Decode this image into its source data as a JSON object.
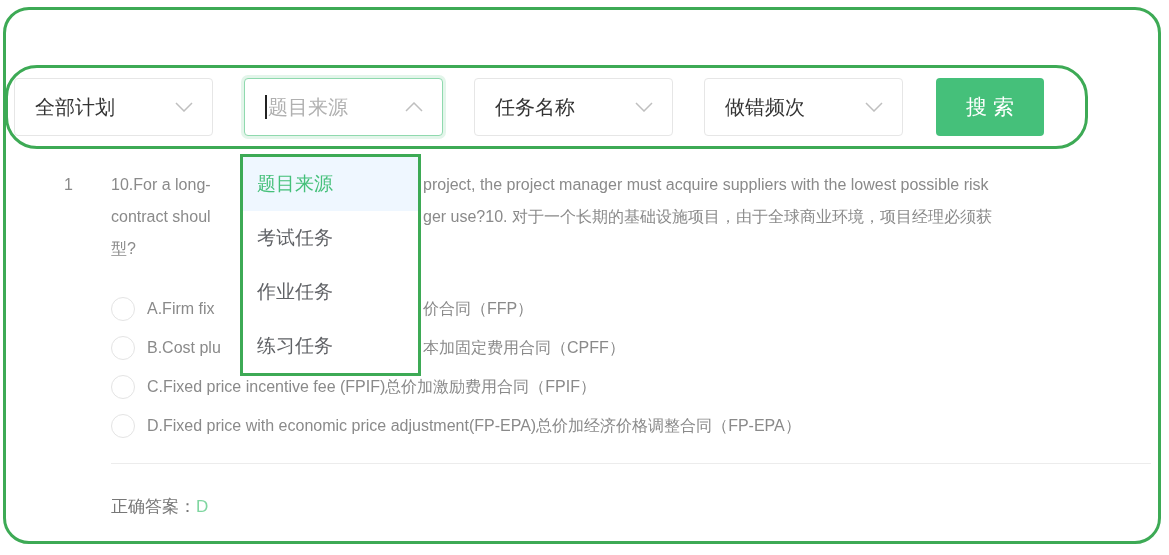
{
  "filters": [
    {
      "value": "全部计划",
      "open": false
    },
    {
      "placeholder": "题目来源",
      "open": true,
      "options": [
        {
          "label": "题目来源",
          "selected": true
        },
        {
          "label": "考试任务",
          "selected": false
        },
        {
          "label": "作业任务",
          "selected": false
        },
        {
          "label": "练习任务",
          "selected": false
        }
      ]
    },
    {
      "value": "任务名称",
      "open": false
    },
    {
      "value": "做错频次",
      "open": false
    }
  ],
  "search_button": "搜 索",
  "question": {
    "number": "1",
    "lines": [
      [
        "10.For a long-",
        "project, the project manager must acquire suppliers with the lowest possible risk"
      ],
      [
        "contract shoul",
        "ger use?10. 对于一个长期的基础设施项目，由于全球商业环境，项目经理必须获"
      ],
      [
        "型?"
      ]
    ],
    "options": [
      {
        "segments": [
          "A.Firm fix",
          "价合同（FFP）"
        ],
        "selected": false
      },
      {
        "segments": [
          "B.Cost plu",
          "本加固定费用合同（CPFF）"
        ],
        "selected": false
      },
      {
        "segments": [
          "C.Fixed price incentive fee (FPIF)总价加激励费用合同（FPIF）"
        ],
        "selected": false
      },
      {
        "segments": [
          "D.Fixed price with economic price adjustment(FP-EPA)总价加经济价格调整合同（FP-EPA）"
        ],
        "selected": false
      }
    ],
    "answer_label": "正确答案：",
    "answer": "D"
  }
}
